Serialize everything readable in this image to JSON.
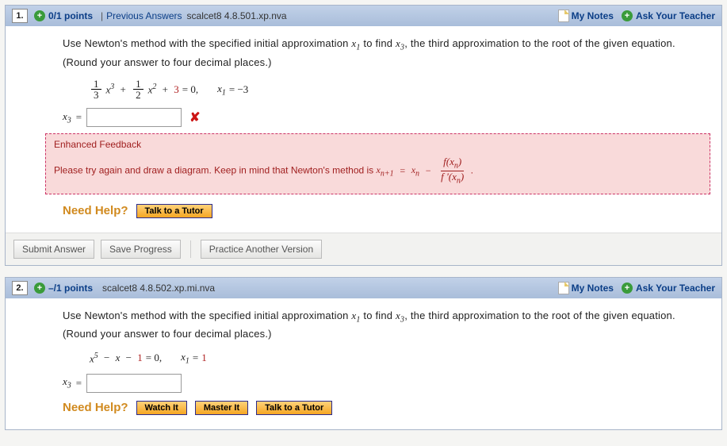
{
  "q1": {
    "num": "1.",
    "points": "0/1 points",
    "prev_answers": "Previous Answers",
    "code": "scalcet8 4.8.501.xp.nva",
    "my_notes": "My Notes",
    "ask": "Ask Your Teacher",
    "instr_a": "Use Newton's method with the specified initial approximation ",
    "instr_b": " to find ",
    "instr_c": ", the third approximation to the root of the given equation. (Round your answer to four decimal places.)",
    "eq_text": " = 0,",
    "x1_text": " = −3",
    "x3_label": " = ",
    "answer_value": "",
    "feedback_title": "Enhanced Feedback",
    "feedback_a": "Please try again and draw a diagram. Keep in mind that Newton's method is  ",
    "feedback_b": ".",
    "need_help": "Need Help?",
    "talk_tutor": "Talk to a Tutor",
    "submit": "Submit Answer",
    "save": "Save Progress",
    "practice": "Practice Another Version"
  },
  "q2": {
    "num": "2.",
    "points": "–/1 points",
    "code": "scalcet8 4.8.502.xp.mi.nva",
    "my_notes": "My Notes",
    "ask": "Ask Your Teacher",
    "instr_a": "Use Newton's method with the specified initial approximation ",
    "instr_b": " to find ",
    "instr_c": ", the third approximation to the root of the given equation. (Round your answer to four decimal places.)",
    "eq_text": " = 0,",
    "x1_text": " = ",
    "x1_val": "1",
    "x3_label": " = ",
    "answer_value": "",
    "need_help": "Need Help?",
    "watch": "Watch It",
    "master": "Master It",
    "talk_tutor": "Talk to a Tutor"
  },
  "math": {
    "x1": "x",
    "x3": "x",
    "frac1_num": "1",
    "frac1_den": "3",
    "frac2_num": "1",
    "frac2_den": "2",
    "plus3": "3",
    "xn1": "x",
    "xn": "x",
    "fxn_top": "f(x",
    "fxn_top2": ")",
    "fxn_bot": "f '(x",
    "fxn_bot2": ")",
    "q2_minus1": "1"
  }
}
